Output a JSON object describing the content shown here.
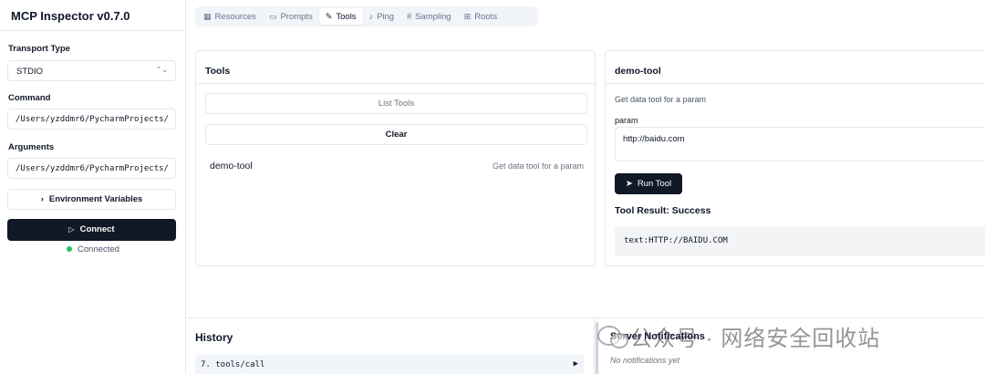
{
  "app": {
    "title": "MCP Inspector v0.7.0"
  },
  "sidebar": {
    "transport_label": "Transport Type",
    "transport_value": "STDIO",
    "command_label": "Command",
    "command_value": "/Users/yzddmr6/PycharmProjects/",
    "arguments_label": "Arguments",
    "arguments_value": "/Users/yzddmr6/PycharmProjects/",
    "env_button": "Environment Variables",
    "connect_button": "Connect",
    "status": "Connected",
    "status_color": "#22c55e"
  },
  "tabs": [
    {
      "label": "Resources",
      "icon": "resources-icon"
    },
    {
      "label": "Prompts",
      "icon": "prompts-icon"
    },
    {
      "label": "Tools",
      "icon": "tools-icon",
      "active": true
    },
    {
      "label": "Ping",
      "icon": "bell-icon"
    },
    {
      "label": "Sampling",
      "icon": "hash-icon"
    },
    {
      "label": "Roots",
      "icon": "folder-tree-icon"
    }
  ],
  "tools_panel": {
    "title": "Tools",
    "list_button": "List Tools",
    "clear_button": "Clear",
    "items": [
      {
        "name": "demo-tool",
        "description": "Get data tool for a param"
      }
    ]
  },
  "tool_detail": {
    "title": "demo-tool",
    "description": "Get data tool for a param",
    "param_label": "param",
    "param_value": "http://baidu.com",
    "run_button": "Run Tool",
    "result_title": "Tool Result: Success",
    "result_text": "text:HTTP://BAIDU.COM"
  },
  "history": {
    "title": "History",
    "items": [
      {
        "label": "7. tools/call"
      }
    ]
  },
  "notifications": {
    "title": "Server Notifications",
    "empty": "No notifications yet"
  },
  "watermark": {
    "text": "公众号 · 网络安全回收站"
  }
}
